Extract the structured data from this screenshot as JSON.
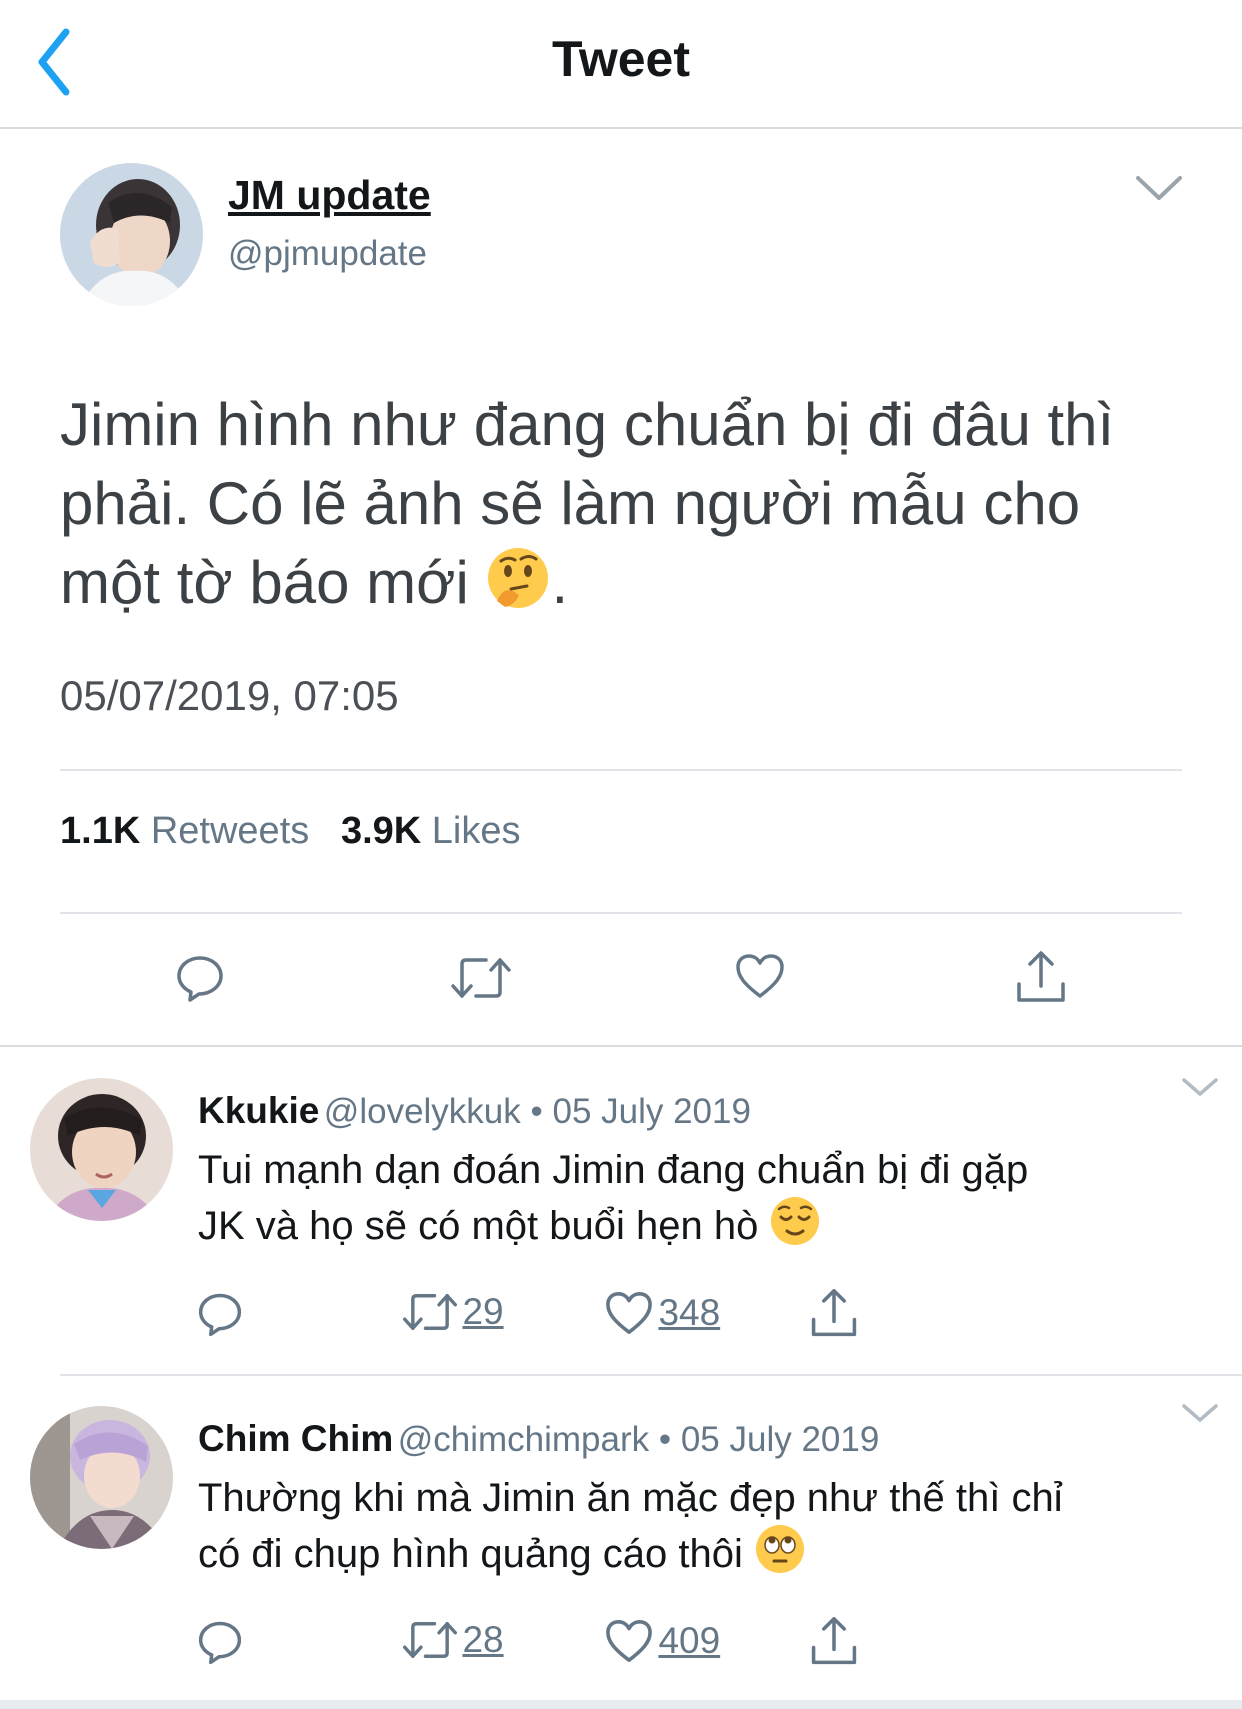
{
  "header": {
    "title": "Tweet",
    "back_icon": "chevron-left-icon"
  },
  "main_tweet": {
    "author_name": "JM update",
    "author_handle": "@pjmupdate",
    "text_line1": "Jimin hình như đang chuẩn bị đi đâu thì",
    "text_line2": "phải. Có lẽ ảnh sẽ làm người mẫu cho",
    "text_line3": "một tờ báo mới",
    "text_end": ".",
    "emoji": "thinking-face-emoji",
    "timestamp": "05/07/2019, 07:05",
    "retweets_count": "1.1K",
    "retweets_label": "Retweets",
    "likes_count": "3.9K",
    "likes_label": "Likes"
  },
  "replies": [
    {
      "name": "Kkukie",
      "meta": "@lovelykkuk • 05 July 2019",
      "line1": "Tui mạnh dạn đoán Jimin đang chuẩn bị đi gặp",
      "line2": "JK và họ sẽ có một buổi hẹn hò",
      "emoji": "relieved-face-emoji",
      "retweets": "29",
      "likes": "348"
    },
    {
      "name": "Chim Chim",
      "meta": "@chimchimpark • 05 July 2019",
      "line1": "Thường khi mà Jimin ăn mặc đẹp như thế thì chỉ",
      "line2": "có đi chụp hình quảng cáo thôi",
      "emoji": "eye-roll-face-emoji",
      "retweets": "28",
      "likes": "409"
    }
  ],
  "colors": {
    "accent": "#1da1f2",
    "icon_gray": "#657786",
    "text": "#14171a"
  }
}
